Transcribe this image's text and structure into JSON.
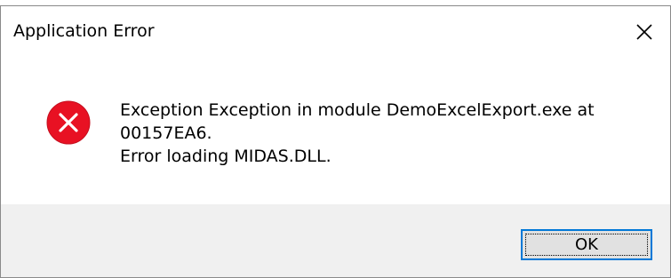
{
  "dialog": {
    "title": "Application Error",
    "close_icon": "close-icon",
    "icon": "error-icon",
    "icon_color": "#e81123",
    "message_lines": [
      "Exception Exception in module DemoExcelExport.exe at",
      "00157EA6.",
      "Error loading MIDAS.DLL."
    ],
    "ok_label": "OK",
    "accent_color": "#0078d7"
  }
}
